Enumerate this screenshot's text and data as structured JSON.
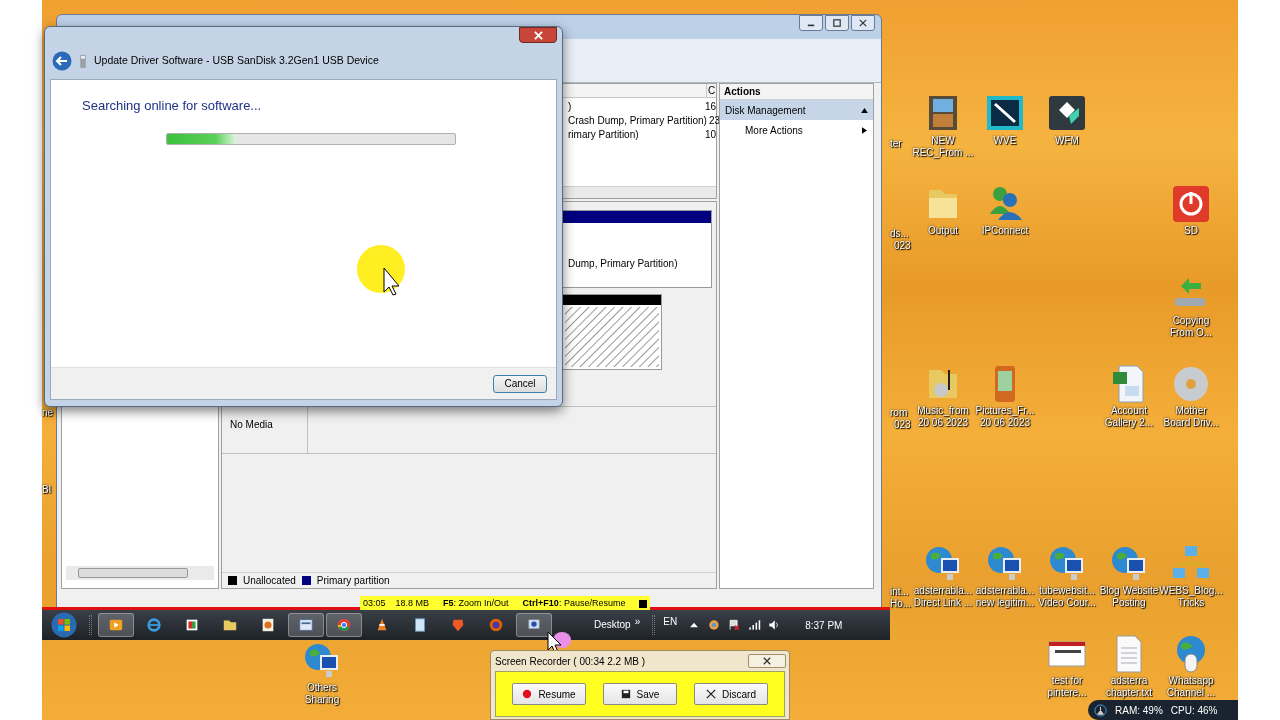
{
  "disk_management": {
    "volume_list": {
      "column_header": "C",
      "rows": [
        {
          "layout": ")",
          "capacity": "16"
        },
        {
          "layout": "Crash Dump, Primary Partition)",
          "capacity": "23"
        },
        {
          "layout": "rimary Partition)",
          "capacity": "10"
        }
      ]
    },
    "graphical_view": {
      "partition_label": "Dump, Primary Partition)",
      "no_media": "No Media"
    },
    "legend": [
      {
        "label": "Unallocated",
        "color": "#000000"
      },
      {
        "label": "Primary partition",
        "color": "#000080"
      }
    ],
    "actions": {
      "title": "Actions",
      "section": "Disk Management",
      "items": [
        "More Actions"
      ]
    }
  },
  "dialog": {
    "title": "Update Driver Software -  USB  SanDisk 3.2Gen1 USB Device",
    "heading": "Searching online for software...",
    "progress": {
      "level": 0.24
    },
    "cancel_button": "Cancel"
  },
  "recorder_bar": {
    "time": "03:05",
    "size": "18.8 MB",
    "hints": [
      {
        "key": "F5",
        "action": ": Zoom In/Out"
      },
      {
        "key": "Ctrl+F10",
        "action": ": Pause/Resume"
      }
    ]
  },
  "taskbar": {
    "apps": [
      {
        "kind": "media",
        "open": true
      },
      {
        "kind": "ie",
        "open": false
      },
      {
        "kind": "app",
        "open": false
      },
      {
        "kind": "explorer",
        "open": false
      },
      {
        "kind": "paint",
        "open": false
      },
      {
        "kind": "window",
        "open": true
      },
      {
        "kind": "chrome",
        "open": true
      },
      {
        "kind": "vlc",
        "open": false
      },
      {
        "kind": "notepad",
        "open": false
      },
      {
        "kind": "brave",
        "open": false
      },
      {
        "kind": "firefox",
        "open": false
      },
      {
        "kind": "recorder",
        "open": true
      }
    ],
    "toolbar": "Desktop",
    "toolbar_more": "»",
    "language": "EN",
    "clock": "8:37 PM"
  },
  "desktop_icons": [
    {
      "kind": "film",
      "lines": [
        "NEW",
        "REC_From ..."
      ]
    },
    {
      "kind": "wve",
      "lines": [
        "WVE"
      ]
    },
    {
      "kind": "wfm",
      "lines": [
        "WFM"
      ]
    },
    {
      "kind": "folder",
      "lines": [
        "Output"
      ]
    },
    {
      "kind": "people",
      "lines": [
        "IPConnect"
      ]
    },
    {
      "kind": "power",
      "lines": [
        "SD"
      ]
    },
    {
      "kind": "usb",
      "lines": [
        "Copying",
        "From O..."
      ]
    },
    {
      "kind": "music",
      "lines": [
        "Music_from",
        "20 06 2023"
      ]
    },
    {
      "kind": "phone",
      "lines": [
        "Pictures_Fr...",
        "20 06 2023"
      ]
    },
    {
      "kind": "excel",
      "lines": [
        "Account",
        "Gallery 2..."
      ]
    },
    {
      "kind": "disc",
      "lines": [
        "Mother",
        "Board Driv..."
      ]
    },
    {
      "kind": "globe",
      "lines": [
        "adsterrabla...",
        "Direct Link ..."
      ]
    },
    {
      "kind": "globe",
      "lines": [
        "adsterrabla...",
        "new legitim..."
      ]
    },
    {
      "kind": "globe",
      "lines": [
        "tubewebsit...",
        "Video Cour..."
      ]
    },
    {
      "kind": "globe",
      "lines": [
        "Blog Website",
        "Posting"
      ]
    },
    {
      "kind": "network",
      "lines": [
        "WEBS_Blog...",
        "Tricks"
      ]
    },
    {
      "kind": "globe",
      "lines": [
        "Others",
        "Sharing"
      ]
    },
    {
      "kind": "screenshot",
      "lines": [
        "test for",
        "pintere..."
      ]
    },
    {
      "kind": "text",
      "lines": [
        "adsterra",
        "chapter.txt"
      ]
    },
    {
      "kind": "globe_mouse",
      "lines": [
        "Whatsapp",
        "Channel ..."
      ]
    }
  ],
  "partial_labels": [
    "ter",
    "ds...",
    "023",
    "ne",
    "rom",
    "023",
    "Bl",
    "int...",
    "Ho..."
  ],
  "screen_recorder": {
    "title": "Screen Recorder ( 00:34  2.2 MB )",
    "buttons": [
      {
        "kind": "record",
        "label": "Resume"
      },
      {
        "kind": "save",
        "label": "Save"
      },
      {
        "kind": "discard",
        "label": "Discard"
      }
    ]
  },
  "system_monitor": {
    "ram": "RAM: 49%",
    "cpu": "CPU: 46%"
  }
}
